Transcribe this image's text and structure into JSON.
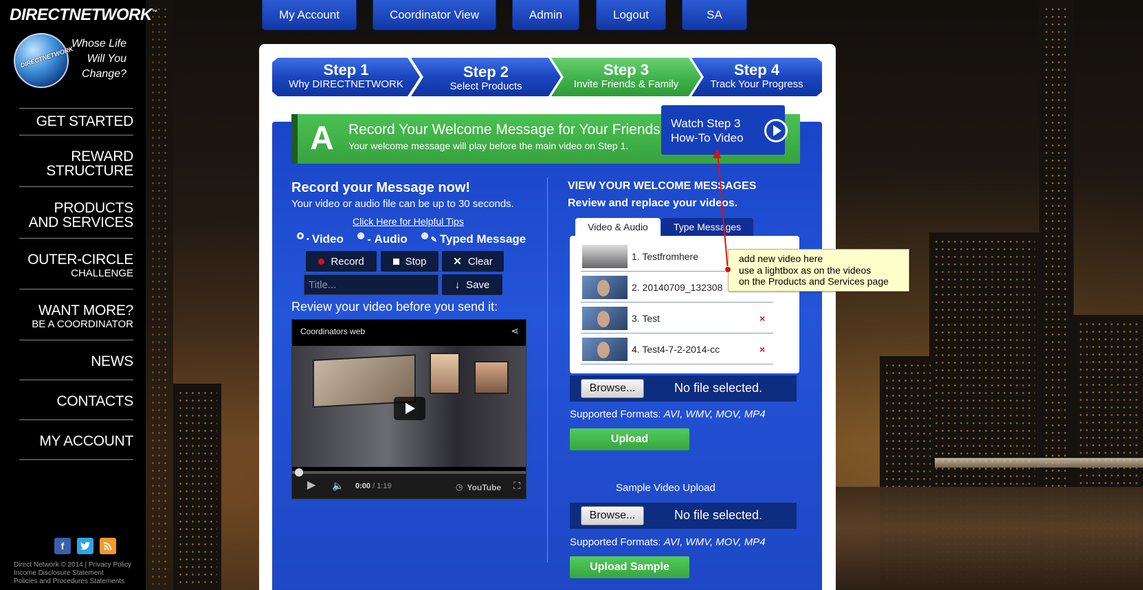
{
  "brand": {
    "logo_text": "DIRECTNETWORK",
    "trademark": "™",
    "globe_label": "DIRECTNETWORK",
    "tagline": [
      "Whose Life",
      "Will You",
      "Change?"
    ]
  },
  "sidebar": {
    "items": [
      {
        "line1": "GET STARTED",
        "line2": ""
      },
      {
        "line1": "REWARD",
        "line2": "STRUCTURE"
      },
      {
        "line1": "PRODUCTS",
        "line2": "AND SERVICES"
      },
      {
        "line1": "OUTER-CIRCLE",
        "line2": "CHALLENGE"
      },
      {
        "line1": "WANT MORE?",
        "line2": "BE A COORDINATOR"
      },
      {
        "line1": "NEWS",
        "line2": ""
      },
      {
        "line1": "CONTACTS",
        "line2": ""
      },
      {
        "line1": "MY ACCOUNT",
        "line2": ""
      }
    ],
    "social": [
      "f",
      "t",
      "rss"
    ],
    "footer": {
      "line1": "Direct Network © 2014 | Privacy Policy",
      "line2": "Income Disclosure Statement",
      "line3": "Policies and Procedures Statements"
    }
  },
  "topnav": [
    "My Account",
    "Coordinator View",
    "Admin",
    "Logout",
    "SA"
  ],
  "steps": [
    {
      "title": "Step 1",
      "subtitle": "Why DIRECTNETWORK"
    },
    {
      "title": "Step 2",
      "subtitle": "Select Products"
    },
    {
      "title": "Step 3",
      "subtitle": "Invite Friends & Family"
    },
    {
      "title": "Step 4",
      "subtitle": "Track Your Progress"
    }
  ],
  "banner": {
    "letter": "A",
    "title": "Record Your Welcome Message for Your Friends",
    "subtitle": "Your welcome message will play before the main video on Step 1."
  },
  "howto": {
    "line1": "Watch Step 3",
    "line2": "How-To Video"
  },
  "recorder": {
    "heading": "Record your Message now!",
    "subheading": "Your video or audio file can be up to 30 seconds.",
    "tips_link": "Click Here for Helpful Tips",
    "modes": [
      {
        "label": "Video",
        "selected": true
      },
      {
        "label": "Audio",
        "selected": false
      },
      {
        "label": "Typed Message",
        "selected": false
      }
    ],
    "record_label": "Record",
    "stop_label": "Stop",
    "clear_label": "Clear",
    "title_placeholder": "Title...",
    "save_label": "Save",
    "review_label": "Review your video before you send it:"
  },
  "player": {
    "video_title": "Coordinators web",
    "time_current": "0:00",
    "time_total": "/ 1:19",
    "brand": "YouTube"
  },
  "messages": {
    "heading": "VIEW YOUR WELCOME MESSAGES",
    "subheading": "Review and replace your videos.",
    "tabs": [
      "Video & Audio",
      "Type Messages"
    ],
    "videos": [
      {
        "name": "1. Testfromhere",
        "deletable": false
      },
      {
        "name": "2. 20140709_132308",
        "deletable": false
      },
      {
        "name": "3. Test",
        "deletable": true
      },
      {
        "name": "4. Test4-7-2-2014-cc",
        "deletable": true
      }
    ],
    "delete_glyph": "×"
  },
  "tooltip": {
    "line1": "add new video here",
    "line2": "use a lightbox as on the videos",
    "line3": "on the Products and Services page"
  },
  "upload": {
    "browse_label": "Browse...",
    "no_file": "No file selected.",
    "formats_label": "Supported Formats:",
    "formats_value": "AVI, WMV, MOV, MP4",
    "upload_label": "Upload",
    "sample_heading": "Sample Video Upload",
    "sample_upload_label": "Upload Sample"
  },
  "colors": {
    "blue": "#1a45c8",
    "green": "#3fb24a",
    "accent_red": "#e01010"
  }
}
